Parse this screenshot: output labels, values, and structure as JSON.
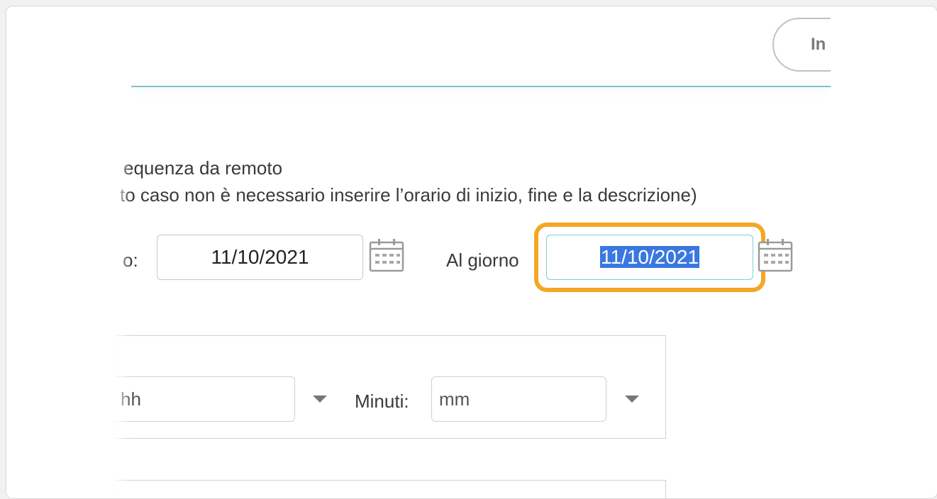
{
  "header": {
    "pill_label": "In"
  },
  "notice": {
    "line1": "equenza da remoto",
    "line2": "to caso non è necessario inserire l’orario di inizio, fine e la descrizione)"
  },
  "date_range": {
    "from_label": "o:",
    "from_value": "11/10/2021",
    "to_label": "Al giorno",
    "to_value": "11/10/2021"
  },
  "time": {
    "hours_placeholder": "hh",
    "minutes_label": "Minuti:",
    "minutes_placeholder": "mm"
  },
  "colors": {
    "accent_rule": "#7dc3c0",
    "focus_ring": "#f5a623",
    "selection": "#3a78e0"
  },
  "icons": {
    "calendar": "calendar-icon",
    "dropdown": "chevron-down-icon"
  }
}
